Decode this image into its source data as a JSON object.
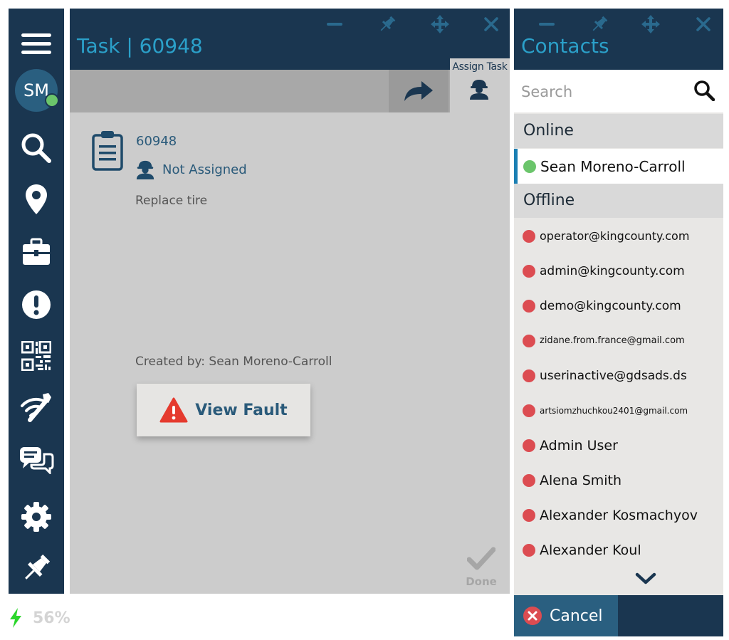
{
  "user": {
    "initials": "SM",
    "status_color": "#6bc56b"
  },
  "battery": {
    "percent_text": "56%"
  },
  "task": {
    "title": "Task | 60948",
    "toolbar": {
      "assign_label": "Assign Task"
    },
    "id": "60948",
    "assignee": "Not Assigned",
    "description": "Replace tire",
    "created_by": "Created by: Sean Moreno-Carroll",
    "view_fault_label": "View Fault",
    "done_label": "Done"
  },
  "contacts": {
    "title": "Contacts",
    "search_placeholder": "Search",
    "online_label": "Online",
    "offline_label": "Offline",
    "online": [
      {
        "name": "Sean Moreno-Carroll"
      }
    ],
    "offline": [
      {
        "name": "operator@kingcounty.com"
      },
      {
        "name": "admin@kingcounty.com"
      },
      {
        "name": "demo@kingcounty.com"
      },
      {
        "name": "zidane.from.france@gmail.com"
      },
      {
        "name": "userinactive@gdsads.ds"
      },
      {
        "name": "artsiomzhuchkou2401@gmail.com"
      },
      {
        "name": "Admin User"
      },
      {
        "name": "Alena Smith"
      },
      {
        "name": "Alexander Kosmachyov"
      },
      {
        "name": "Alexander Koul"
      }
    ],
    "cancel_label": "Cancel"
  },
  "colors": {
    "sidebar": "#1a3650",
    "accent": "#2ba0c9",
    "online": "#6bc56b",
    "offline": "#dc4c51",
    "warning": "#e53a2e"
  }
}
